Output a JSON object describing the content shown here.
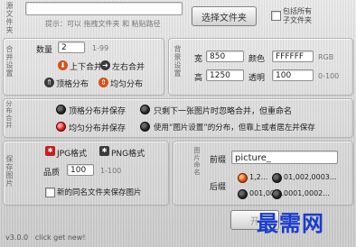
{
  "top": {
    "side_label": "源文件夹",
    "path_value": "",
    "hint": "提示：可以 拖拽文件夹 和 粘贴路径",
    "select_folder_button": "选择文件夹",
    "include_subfolders_line1": "包括所有",
    "include_subfolders_line2": "子文件夹",
    "include_subfolders_checked": false
  },
  "merge": {
    "side_label": "合并设置",
    "count_label": "数量",
    "count_value": "2",
    "count_range": "1-99",
    "opt_top_bottom": "上下合并",
    "opt_left_right": "左右合并",
    "opt_top_layout": "顶格分布",
    "opt_even_layout": "均匀分布"
  },
  "background": {
    "side_label": "背景设置",
    "width_label": "宽",
    "width_value": "850",
    "height_label": "高",
    "height_value": "1250",
    "color_label": "颜色",
    "color_value": "FFFFFF",
    "color_unit": "RGB",
    "opacity_label": "透明",
    "opacity_value": "100",
    "opacity_range": "0-100"
  },
  "distribution": {
    "side_label": "分布合并",
    "opt_1": "顶格分布并保存",
    "opt_2": "只剩下一张图片时忽略合并，但重命名",
    "opt_3": "均匀分布并保存",
    "opt_4": "使用“图片设置”的分布，但靠上或者居左并保存"
  },
  "save": {
    "side_label": "保存图片",
    "jpg_label": "JPG格式",
    "png_label": "PNG格式",
    "quality_label": "品质",
    "quality_value": "100",
    "quality_range": "1-100",
    "new_folder_label": "新的同名文件夹保存图片"
  },
  "naming": {
    "side_label": "图片命名",
    "prefix_label": "前缀",
    "prefix_value": "picture_",
    "suffix_label": "后缀",
    "suffix_opt_1": "1,2...",
    "suffix_opt_2": "01,002,0003...",
    "suffix_opt_3": "001,002...",
    "suffix_opt_4": "0001,0002..."
  },
  "start_button": "开",
  "footer": {
    "version": "v3.0.0   click get new!",
    "watermark": "最需网"
  },
  "colors": {
    "accent_orange": "#e2571b",
    "accent_red": "#d22222",
    "watermark_blue": "#1a3ccc"
  }
}
